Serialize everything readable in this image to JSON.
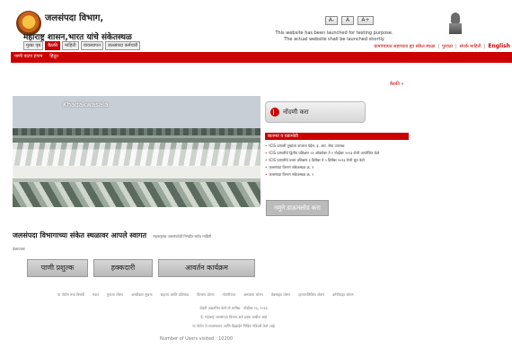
{
  "header": {
    "org_name": "जलसंपदा विभाग,",
    "gov_name": "महाराष्ट्र शासन,भारत यांचे संकेतस्थळ",
    "font_controls": [
      "A-",
      "A",
      "A+"
    ],
    "notice_line1": "This website has been launched for testing purpose.",
    "notice_line2": "The actual website shall be launched shortly"
  },
  "main_nav": [
    "मुख्य पृष्ठ",
    "बैठकी",
    "माहिती",
    "व्यवस्थापन",
    "जलसंपदा कर्मचारी"
  ],
  "lang_links": [
    "ग्रामपंचायत सहाय्यता ह्या संकेत स्थळा",
    "पुरवठा",
    "संपर्क माहिती",
    "English"
  ],
  "sub_nav": [
    "पाणी वाटप हंगाम",
    "हिंदूत"
  ],
  "more_link": "बैठकी »",
  "photo": {
    "caption": "Khadakwasala"
  },
  "register_button": "नोंदणी करा",
  "news": {
    "header": "बातम्या व घडामोडी",
    "items": [
      "ICIS प्रणाली तुम्हांला वापरता येईल. इ. आर. सेवा उपलब्ध",
      "ICIS प्रणालीचे द्वितीय प्रशिक्षण २१ ऑक्टोबर ते २ नोव्हेंबर २०१३ रोजी आयोजित केले",
      "ICIS प्रणालीचे प्रथम प्रशिक्षण ३ डिसेंबर ते ५ डिसेंबर २०१३ रोजी सुरु केले",
      "जलसंपदा विभाग संकेतस्थळ क्र. १",
      "जलसंपदा विभाग संकेतस्थळ क्र. २"
    ]
  },
  "download_button": "नमुने डाऊनलोड करा",
  "welcome": {
    "title": "जलसंपदा विभागाच्या संकेत स्थळावर आपले स्वागत",
    "subtitle": "महाराष्ट्राचा जलसंपदेची निगडीत सर्वच माहिती",
    "line2": "वेळापत्रक"
  },
  "actions": [
    "पाणी प्रशुल्क",
    "हक्कदारी",
    "आवर्तन कार्यक्रम"
  ],
  "footer": {
    "links": [
      "या पोर्टल तथा विषयी",
      "मदत",
      "गुप्तता धोरण",
      "अस्वीकार सूचना",
      "सहाय्य आणि प्रतिसाद",
      "वितरण धोरण",
      "गोपनीयता",
      "अस्पष्टता धोरण",
      "वेबसाइट धोरण",
      "हायपरलिंकिंग धोरण",
      "कॉपीराइट धोरण"
    ],
    "line1": "शेवटी अद्यतनित केले तो तारीख : नोव्हेंबर २६, २०१३",
    "line2": "© महाराष्ट्र जलसंपदा विभाग,सर्व हक्क राखीव आहे",
    "line3": "या पोर्टल चे व्यवस्थापन आणि डिझाईन निविध गडिवर्स केले आहे",
    "visitors": "Number of Users visited : 10200"
  }
}
